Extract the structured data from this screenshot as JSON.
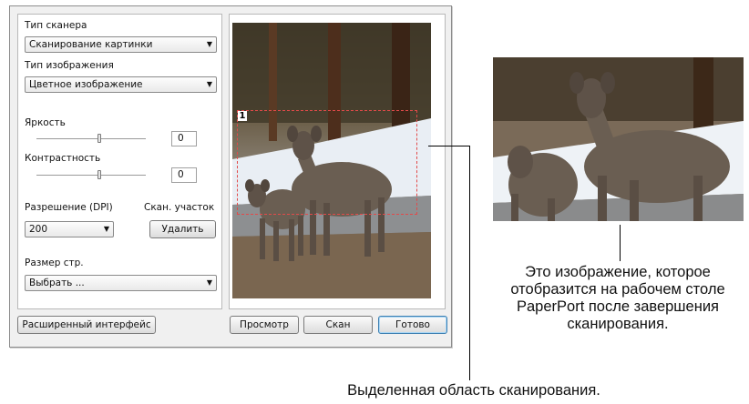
{
  "left_panel": {
    "scanner_type_label": "Тип сканера",
    "scanner_type_value": "Сканирование картинки",
    "image_type_label": "Тип изображения",
    "image_type_value": "Цветное изображение",
    "brightness_label": "Яркость",
    "brightness_value": "0",
    "contrast_label": "Контрастность",
    "contrast_value": "0",
    "resolution_label": "Разрешение (DPI)",
    "resolution_value": "200",
    "scan_area_label": "Скан. участок",
    "delete_button": "Удалить",
    "page_size_label": "Размер стр.",
    "page_size_value": "Выбрать ..."
  },
  "buttons": {
    "advanced": "Расширенный интерфейс",
    "preview": "Просмотр",
    "scan": "Скан",
    "done": "Готово"
  },
  "preview": {
    "selection_number": "1"
  },
  "icons": {
    "dropdown": "chevron-down-icon",
    "slider": "slider-thumb"
  },
  "callouts": {
    "result_caption": "Это изображение, которое отобразится на рабочем столе PaperPort после завершения сканирования.",
    "selection_caption": "Выделенная область сканирования."
  }
}
